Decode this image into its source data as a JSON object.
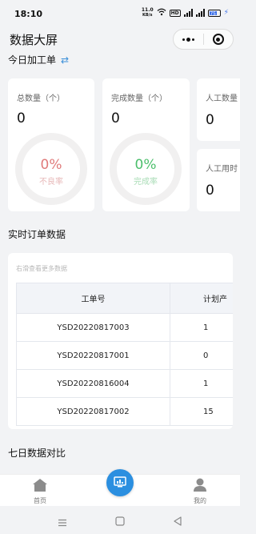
{
  "status": {
    "time": "18:10",
    "net_speed": "11.0",
    "net_unit": "KB/s",
    "hd": "HD",
    "battery": "75"
  },
  "nav": {
    "title": "数据大屏"
  },
  "today": {
    "title": "今日加工单"
  },
  "cards": {
    "total": {
      "label": "总数量（个）",
      "value": "0",
      "pct": "0%",
      "rate_label": "不良率",
      "pct_color": "#e07a7a"
    },
    "done": {
      "label": "完成数量（个）",
      "value": "0",
      "pct": "0%",
      "rate_label": "完成率",
      "pct_color": "#4cbf6c"
    },
    "labor_qty": {
      "label": "人工数量",
      "value": "0"
    },
    "labor_time": {
      "label": "人工用时",
      "value": "0"
    }
  },
  "orders": {
    "title": "实时订单数据",
    "hint": "右滑查看更多数据",
    "columns": [
      "工单号",
      "计划产"
    ],
    "rows": [
      {
        "order_no": "YSD20220817003",
        "planned": "1"
      },
      {
        "order_no": "YSD20220817001",
        "planned": "0"
      },
      {
        "order_no": "YSD20220816004",
        "planned": "1"
      },
      {
        "order_no": "YSD20220817002",
        "planned": "15"
      }
    ]
  },
  "seven_day": {
    "title": "七日数据对比"
  },
  "tabbar": {
    "home": "首页",
    "mine": "我的"
  },
  "colors": {
    "accent": "#2b8fe0"
  }
}
